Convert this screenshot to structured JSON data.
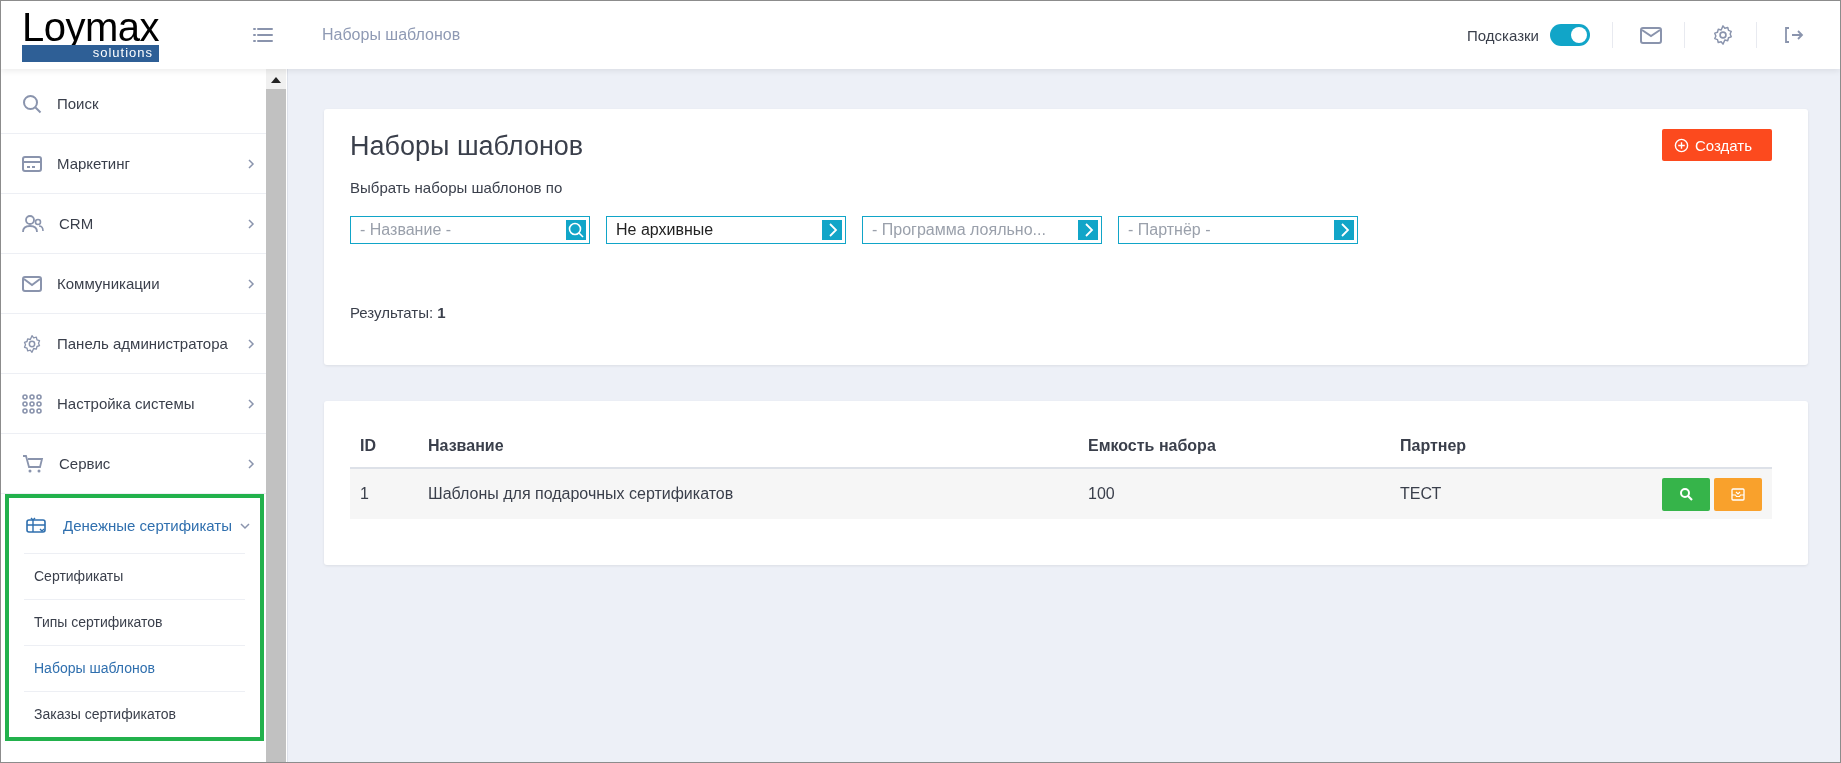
{
  "header": {
    "logo": {
      "name": "Loymax",
      "tagline": "solutions"
    },
    "breadcrumb": "Наборы шаблонов",
    "hints": {
      "label": "Подсказки",
      "on": true
    }
  },
  "sidebar": {
    "items": [
      {
        "label": "Поиск",
        "expandable": false,
        "expanded": false,
        "highlighted": false
      },
      {
        "label": "Маркетинг",
        "expandable": true,
        "expanded": false,
        "highlighted": false
      },
      {
        "label": "CRM",
        "expandable": true,
        "expanded": false,
        "highlighted": false
      },
      {
        "label": "Коммуникации",
        "expandable": true,
        "expanded": false,
        "highlighted": false
      },
      {
        "label": "Панель администратора",
        "expandable": true,
        "expanded": false,
        "highlighted": false
      },
      {
        "label": "Настройка системы",
        "expandable": true,
        "expanded": false,
        "highlighted": false
      },
      {
        "label": "Сервис",
        "expandable": true,
        "expanded": false,
        "highlighted": false
      },
      {
        "label": "Денежные сертификаты",
        "expandable": true,
        "expanded": true,
        "highlighted": true,
        "children": [
          {
            "label": "Сертификаты",
            "selected": false
          },
          {
            "label": "Типы сертификатов",
            "selected": false
          },
          {
            "label": "Наборы шаблонов",
            "selected": true
          },
          {
            "label": "Заказы сертификатов",
            "selected": false
          }
        ]
      }
    ]
  },
  "filter_panel": {
    "title": "Наборы шаблонов",
    "create_button": "Создать",
    "filter_label": "Выбрать наборы шаблонов по",
    "filters": [
      {
        "kind": "search",
        "placeholder": "- Название -"
      },
      {
        "kind": "select",
        "value": "Не архивные"
      },
      {
        "kind": "select",
        "placeholder": "- Программа лояльно..."
      },
      {
        "kind": "select",
        "placeholder": "- Партнёр -"
      }
    ],
    "results_label": "Результаты:",
    "results_count": "1"
  },
  "table": {
    "columns": [
      "ID",
      "Название",
      "Емкость набора",
      "Партнер"
    ],
    "rows": [
      {
        "cells": [
          "1",
          "Шаблоны для подарочных сертификатов",
          "100",
          "ТЕСТ"
        ]
      }
    ]
  }
}
